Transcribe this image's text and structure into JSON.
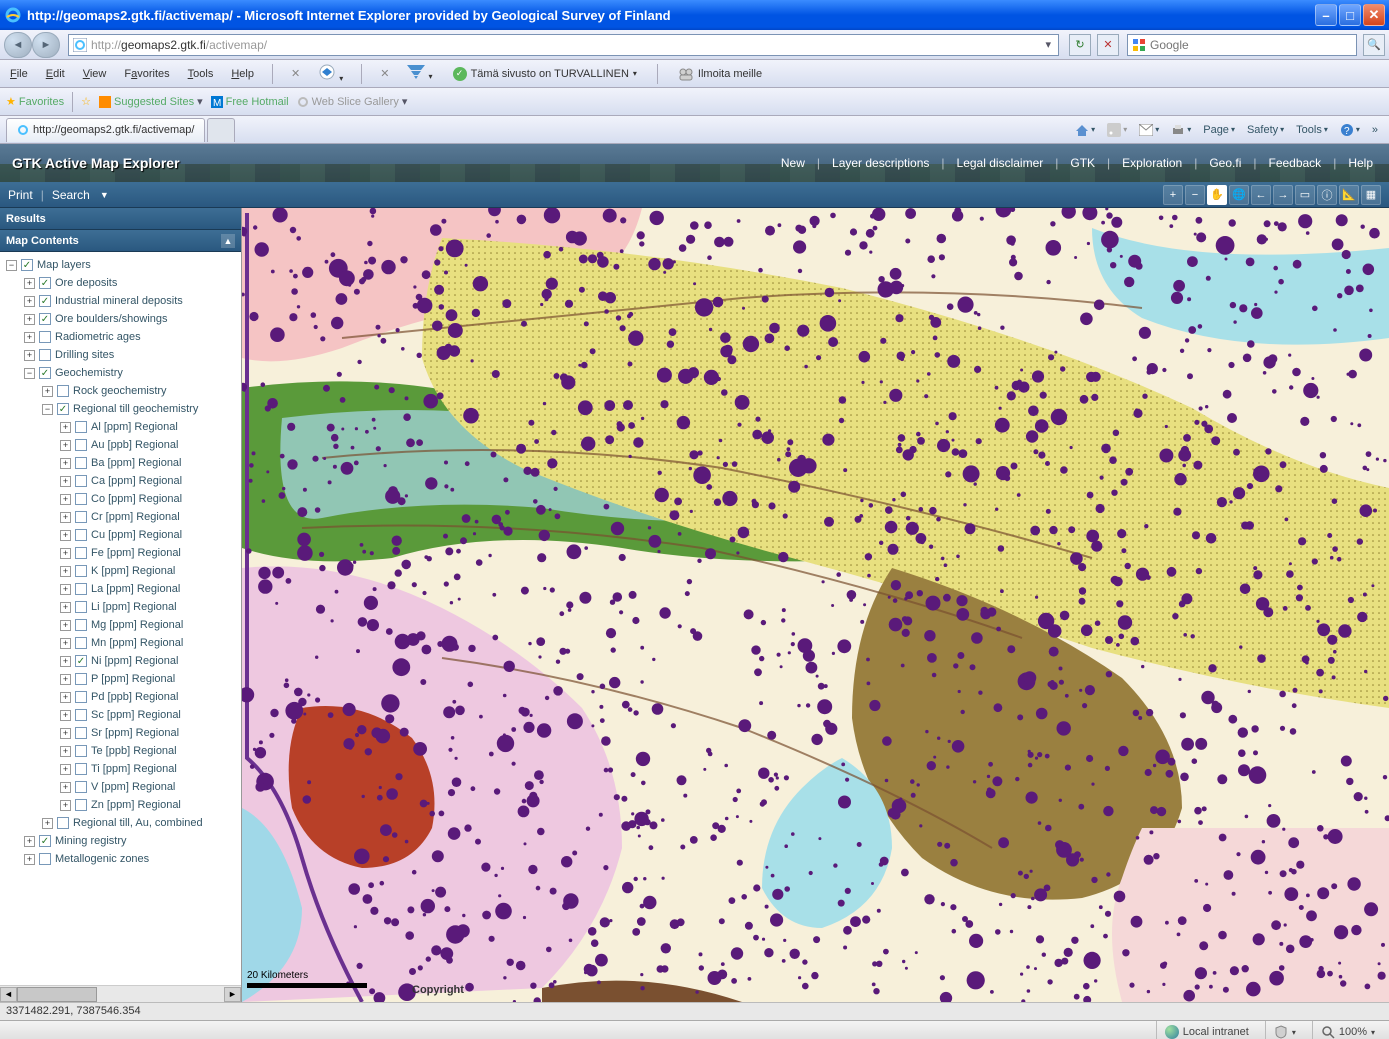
{
  "window": {
    "title": "http://geomaps2.gtk.fi/activemap/ - Microsoft Internet Explorer provided by Geological Survey of Finland"
  },
  "address": {
    "url_prefix": "http://",
    "url_host": "geomaps2.gtk.fi",
    "url_path": "/activemap/"
  },
  "search": {
    "placeholder": "Google"
  },
  "menu": {
    "file": "File",
    "edit": "Edit",
    "view": "View",
    "favorites": "Favorites",
    "tools": "Tools",
    "help": "Help",
    "safety_text": "Tämä sivusto on TURVALLINEN",
    "report": "Ilmoita meille"
  },
  "favbar": {
    "favorites": "Favorites",
    "suggested": "Suggested Sites",
    "hotmail": "Free Hotmail",
    "webslice": "Web Slice Gallery"
  },
  "tab": {
    "title": "http://geomaps2.gtk.fi/activemap/"
  },
  "ie_toolbar": {
    "page": "Page",
    "safety": "Safety",
    "tools": "Tools"
  },
  "app": {
    "title": "GTK Active Map Explorer",
    "links": [
      "New",
      "Layer descriptions",
      "Legal disclaimer",
      "GTK",
      "Exploration",
      "Geo.fi",
      "Feedback",
      "Help"
    ]
  },
  "app_toolbar": {
    "print": "Print",
    "search": "Search"
  },
  "panels": {
    "results": "Results",
    "contents": "Map Contents"
  },
  "tree": {
    "root": "Map layers",
    "items": [
      {
        "label": "Ore deposits",
        "checked": true,
        "indent": 1
      },
      {
        "label": "Industrial mineral deposits",
        "checked": true,
        "indent": 1
      },
      {
        "label": "Ore boulders/showings",
        "checked": true,
        "indent": 1
      },
      {
        "label": "Radiometric ages",
        "checked": false,
        "indent": 1
      },
      {
        "label": "Drilling sites",
        "checked": false,
        "indent": 1
      },
      {
        "label": "Geochemistry",
        "checked": true,
        "indent": 1,
        "expanded": true
      },
      {
        "label": "Rock geochemistry",
        "checked": false,
        "indent": 2
      },
      {
        "label": "Regional till geochemistry",
        "checked": true,
        "indent": 2,
        "expanded": true
      },
      {
        "label": "Al [ppm] Regional",
        "checked": false,
        "indent": 3
      },
      {
        "label": "Au [ppb] Regional",
        "checked": false,
        "indent": 3
      },
      {
        "label": "Ba [ppm] Regional",
        "checked": false,
        "indent": 3
      },
      {
        "label": "Ca [ppm] Regional",
        "checked": false,
        "indent": 3
      },
      {
        "label": "Co [ppm] Regional",
        "checked": false,
        "indent": 3
      },
      {
        "label": "Cr [ppm] Regional",
        "checked": false,
        "indent": 3
      },
      {
        "label": "Cu [ppm] Regional",
        "checked": false,
        "indent": 3
      },
      {
        "label": "Fe [ppm] Regional",
        "checked": false,
        "indent": 3
      },
      {
        "label": "K [ppm] Regional",
        "checked": false,
        "indent": 3
      },
      {
        "label": "La [ppm] Regional",
        "checked": false,
        "indent": 3
      },
      {
        "label": "Li [ppm] Regional",
        "checked": false,
        "indent": 3
      },
      {
        "label": "Mg [ppm] Regional",
        "checked": false,
        "indent": 3
      },
      {
        "label": "Mn [ppm] Regional",
        "checked": false,
        "indent": 3
      },
      {
        "label": "Ni [ppm] Regional",
        "checked": true,
        "indent": 3
      },
      {
        "label": "P [ppm] Regional",
        "checked": false,
        "indent": 3
      },
      {
        "label": "Pd [ppb] Regional",
        "checked": false,
        "indent": 3
      },
      {
        "label": "Sc [ppm] Regional",
        "checked": false,
        "indent": 3
      },
      {
        "label": "Sr [ppm] Regional",
        "checked": false,
        "indent": 3
      },
      {
        "label": "Te [ppb] Regional",
        "checked": false,
        "indent": 3
      },
      {
        "label": "Ti [ppm] Regional",
        "checked": false,
        "indent": 3
      },
      {
        "label": "V [ppm] Regional",
        "checked": false,
        "indent": 3
      },
      {
        "label": "Zn [ppm] Regional",
        "checked": false,
        "indent": 3
      },
      {
        "label": "Regional till, Au, combined",
        "checked": false,
        "indent": 2
      },
      {
        "label": "Mining registry",
        "checked": true,
        "indent": 1
      },
      {
        "label": "Metallogenic zones",
        "checked": false,
        "indent": 1
      }
    ]
  },
  "map": {
    "scale_label": "20 Kilometers",
    "copyright": "Copyright"
  },
  "status": {
    "coords": "3371482.291, 7387546.354",
    "zone": "Local intranet",
    "zoom": "100%"
  }
}
